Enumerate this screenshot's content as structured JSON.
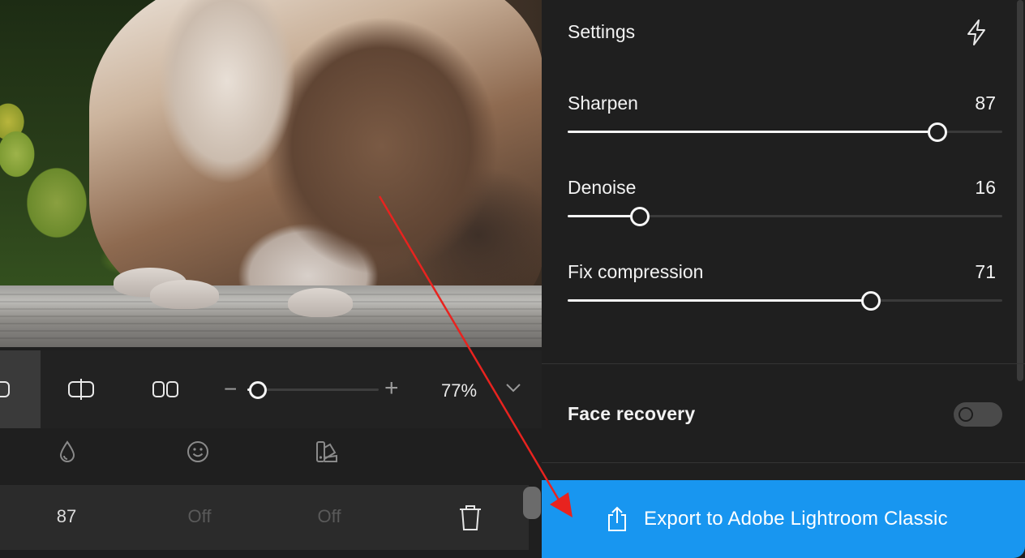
{
  "preview": {
    "description_icon": "photo-preview"
  },
  "toolbar": {
    "views": [
      {
        "name": "single-view",
        "icon": "single-view-icon",
        "active": true
      },
      {
        "name": "split-view",
        "icon": "split-view-icon",
        "active": false
      },
      {
        "name": "side-by-side-view",
        "icon": "side-by-side-view-icon",
        "active": false
      }
    ],
    "zoom": {
      "minus": "−",
      "plus": "+",
      "value_label": "77%",
      "level": 0.08
    }
  },
  "models_table": {
    "column_icons": [
      "drop-icon",
      "face-icon",
      "palette-icon"
    ],
    "row": {
      "sharpen": "87",
      "face": "Off",
      "color": "Off"
    }
  },
  "settings": {
    "title": "Settings",
    "sliders": [
      {
        "label": "Sharpen",
        "value": "87",
        "fraction": 0.85
      },
      {
        "label": "Denoise",
        "value": "16",
        "fraction": 0.166
      },
      {
        "label": "Fix compression",
        "value": "71",
        "fraction": 0.697
      }
    ],
    "face_recovery": {
      "label": "Face recovery",
      "enabled": false
    }
  },
  "export": {
    "label": "Export to Adobe Lightroom Classic"
  },
  "colors": {
    "accent": "#1896f0",
    "annotation_arrow": "#e8231f"
  }
}
